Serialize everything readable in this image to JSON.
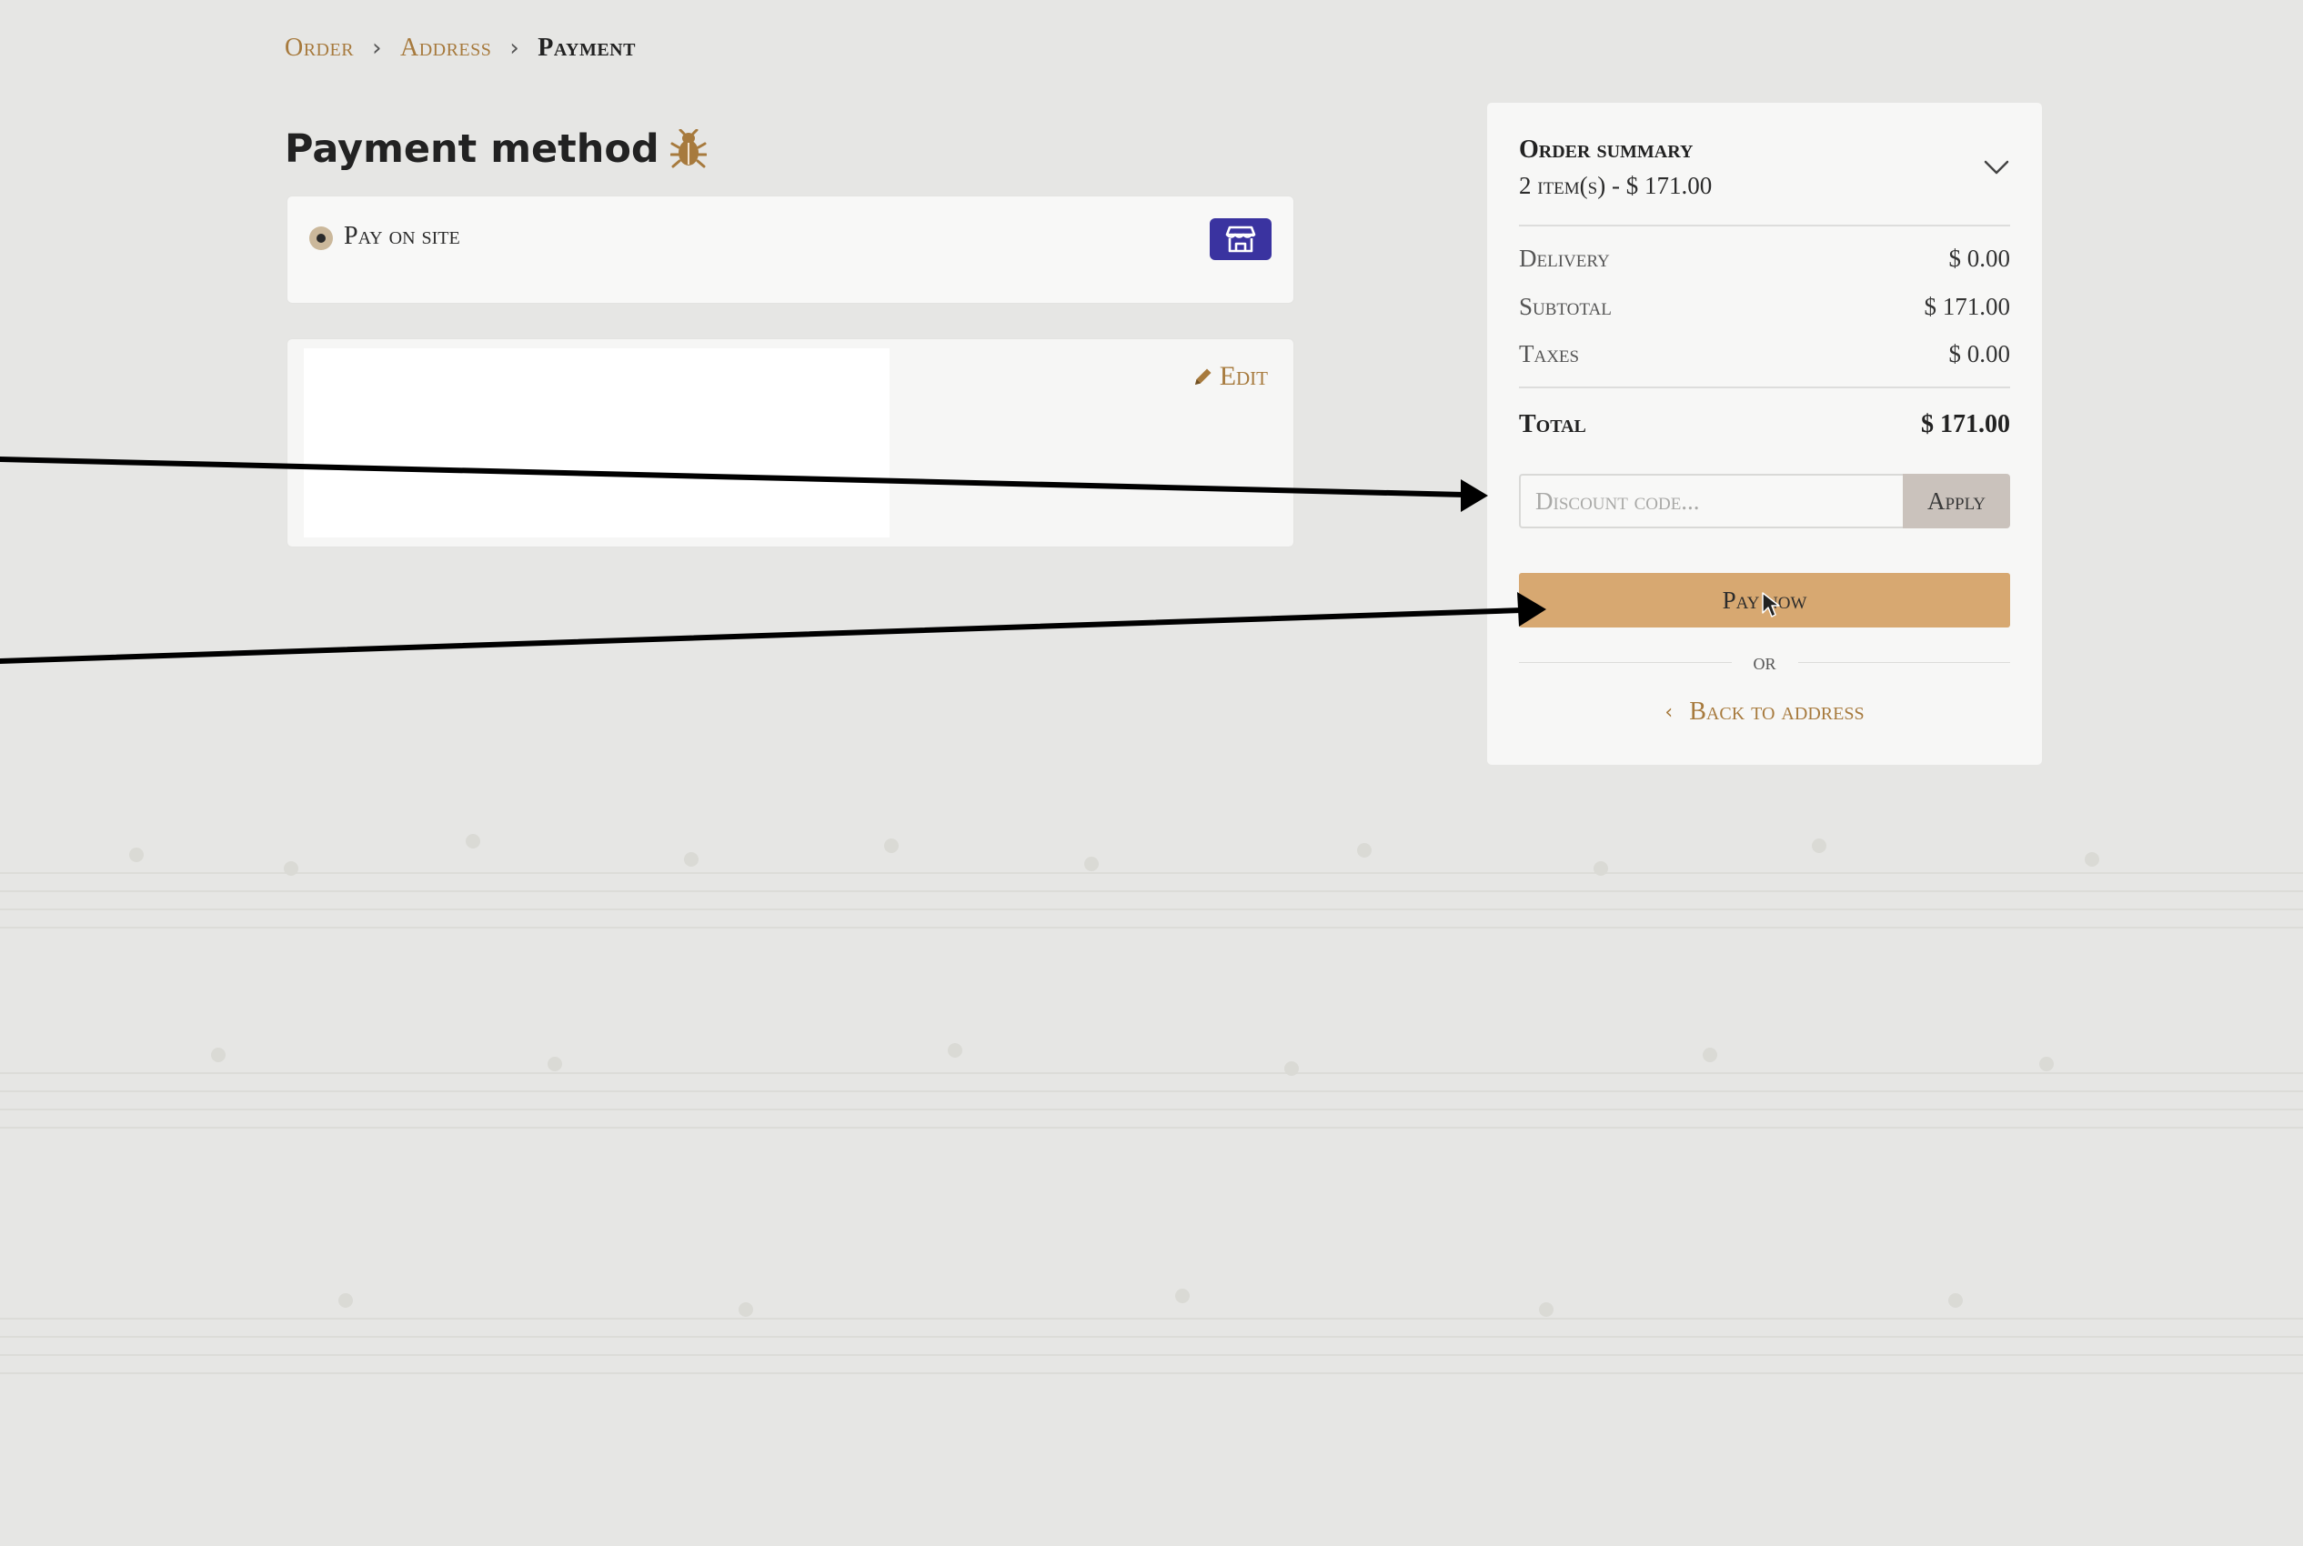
{
  "breadcrumb": {
    "items": [
      {
        "label": "Order"
      },
      {
        "label": "Address"
      },
      {
        "label": "Payment"
      }
    ]
  },
  "page": {
    "title": "Payment method",
    "title_icon": "bug-icon"
  },
  "payment_method": {
    "option_label": "Pay on site",
    "selected": true,
    "badge_icon": "storefront-icon",
    "badge_color": "#3a33a0"
  },
  "details": {
    "edit_label": "Edit",
    "edit_icon": "pencil-icon"
  },
  "summary": {
    "title": "Order summary",
    "items_text": "2 item(s) - $ 171.00",
    "toggle_icon": "chevron-down-icon",
    "rows": [
      {
        "label": "Delivery",
        "value": "$ 0.00"
      },
      {
        "label": "Subtotal",
        "value": "$ 171.00"
      },
      {
        "label": "Taxes",
        "value": "$ 0.00"
      }
    ],
    "total_label": "Total",
    "total_value": "$ 171.00",
    "discount_placeholder": "Discount code...",
    "discount_value": "",
    "apply_label": "Apply",
    "pay_label": "Pay now",
    "or_label": "or",
    "back_label": "Back to address",
    "back_icon": "chevron-left-icon"
  },
  "colors": {
    "accent": "#a77a3d",
    "pay_button": "#d7a871",
    "apply_button": "#cac2bc",
    "background": "#e6e6e4"
  }
}
